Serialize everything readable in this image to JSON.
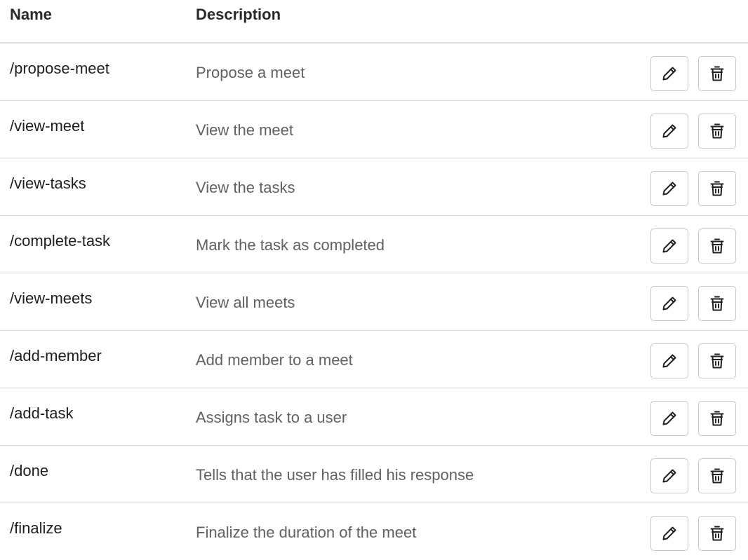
{
  "header": {
    "name_label": "Name",
    "description_label": "Description"
  },
  "commands": [
    {
      "name": "/propose-meet",
      "description": "Propose a meet"
    },
    {
      "name": "/view-meet",
      "description": "View the meet"
    },
    {
      "name": "/view-tasks",
      "description": "View the tasks"
    },
    {
      "name": "/complete-task",
      "description": "Mark the task as completed"
    },
    {
      "name": "/view-meets",
      "description": "View all meets"
    },
    {
      "name": "/add-member",
      "description": "Add member to a meet"
    },
    {
      "name": "/add-task",
      "description": "Assigns task to a user"
    },
    {
      "name": "/done",
      "description": "Tells that the user has filled his response"
    },
    {
      "name": "/finalize",
      "description": "Finalize the duration of the meet"
    }
  ],
  "icons": {
    "edit": "pencil-icon",
    "delete": "trash-icon"
  }
}
